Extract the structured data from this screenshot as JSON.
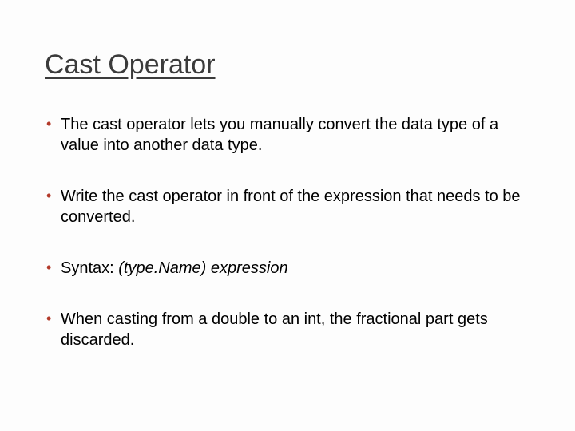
{
  "slide": {
    "title": "Cast Operator",
    "bullets": [
      {
        "text": "The cast operator lets you manually convert the data type of a value into another data type."
      },
      {
        "text": "Write the cast operator in front of the expression that needs to be converted."
      },
      {
        "prefix": "Syntax: ",
        "italic": "(type.Name) expression"
      },
      {
        "text": "When casting from a double to an int, the fractional part gets discarded."
      }
    ]
  }
}
